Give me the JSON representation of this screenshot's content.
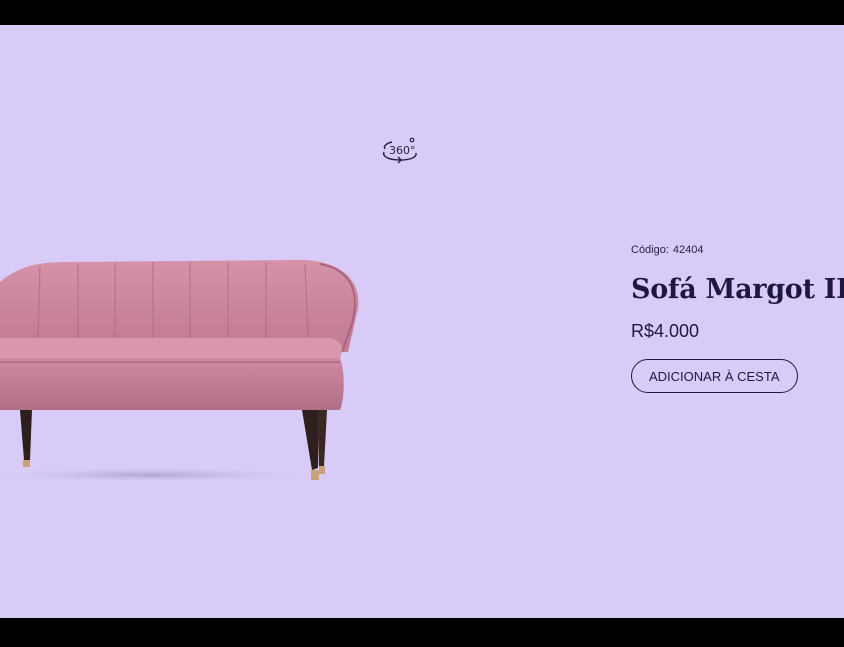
{
  "product": {
    "code_label": "Código:",
    "code_value": "42404",
    "name": "Sofá Margot II",
    "price": "R$4.000",
    "add_to_cart_label": "ADICIONAR À CESTA"
  },
  "viewer": {
    "rotate_label": "360°",
    "rotate_icon": "rotate-360-icon"
  },
  "colors": {
    "background": "#d9cbf7",
    "text": "#1e1744",
    "sofa": "#c67f98"
  }
}
